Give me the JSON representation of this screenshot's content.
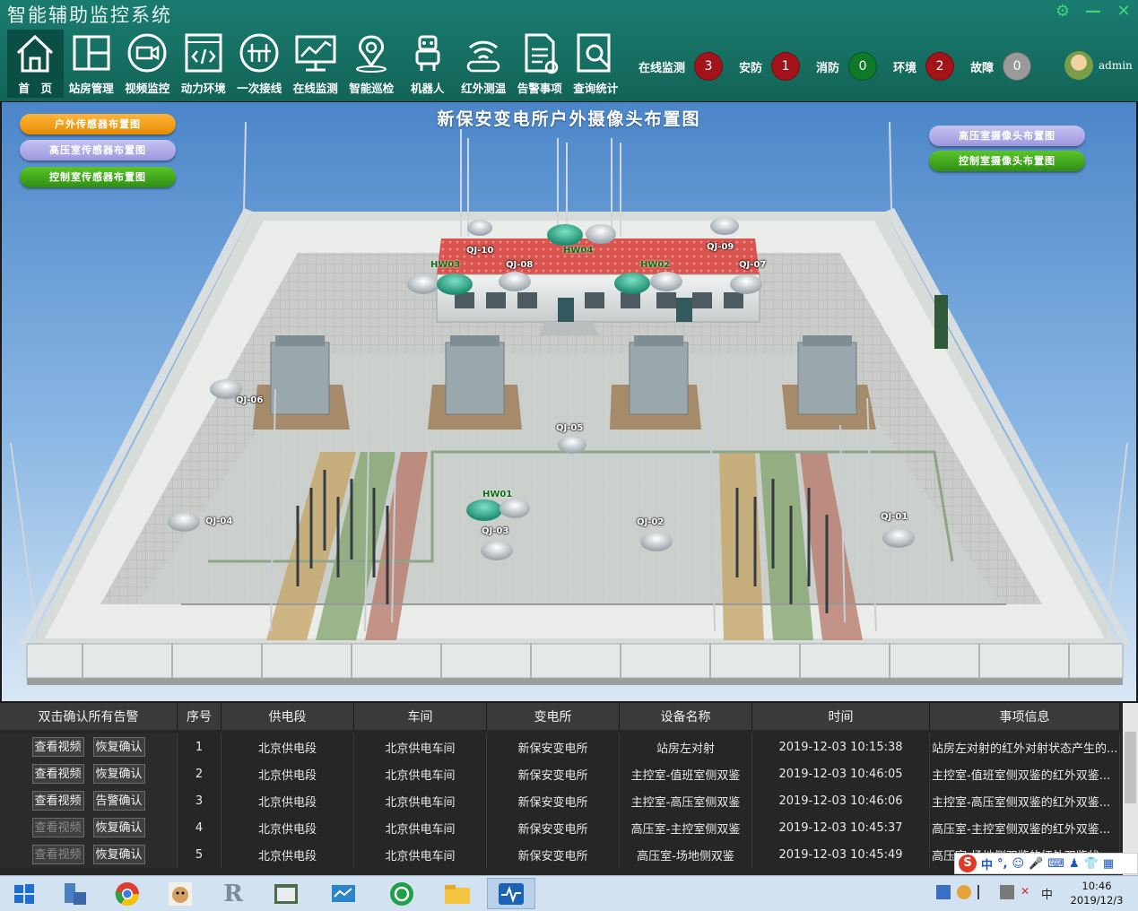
{
  "app": {
    "title": "智能辅助监控系统"
  },
  "nav": {
    "items": [
      {
        "label": "首　页",
        "icon": "home-icon"
      },
      {
        "label": "站房管理",
        "icon": "layout-icon"
      },
      {
        "label": "视频监控",
        "icon": "video-camera-icon"
      },
      {
        "label": "动力环境",
        "icon": "code-window-icon"
      },
      {
        "label": "一次接线",
        "icon": "wiring-icon"
      },
      {
        "label": "在线监测",
        "icon": "monitor-chart-icon"
      },
      {
        "label": "智能巡检",
        "icon": "location-pin-icon"
      },
      {
        "label": "机器人",
        "icon": "robot-icon"
      },
      {
        "label": "红外测温",
        "icon": "infrared-icon"
      },
      {
        "label": "告警事项",
        "icon": "document-icon"
      },
      {
        "label": "查询统计",
        "icon": "search-document-icon"
      }
    ]
  },
  "status": [
    {
      "label": "在线监测",
      "count": "3",
      "color": "#a3141a"
    },
    {
      "label": "安防",
      "count": "1",
      "color": "#a3141a"
    },
    {
      "label": "消防",
      "count": "0",
      "color": "#0e7a2a"
    },
    {
      "label": "环境",
      "count": "2",
      "color": "#a3141a"
    },
    {
      "label": "故障",
      "count": "0",
      "color": "#9a9a9a"
    }
  ],
  "user": {
    "name": "admin"
  },
  "map": {
    "title": "新保安变电所户外摄像头布置图",
    "left_buttons": [
      "户外传感器布置图",
      "高压室传感器布置图",
      "控制室传感器布置图"
    ],
    "right_buttons": [
      "高压室摄像头布置图",
      "控制室摄像头布置图"
    ],
    "cameras": [
      "QJ-10",
      "QJ-09",
      "QJ-08",
      "QJ-07",
      "QJ-06",
      "QJ-05",
      "QJ-04",
      "QJ-03",
      "QJ-02",
      "QJ-01"
    ],
    "thermal": [
      "HW04",
      "HW03",
      "HW02",
      "HW01"
    ]
  },
  "table": {
    "headers": [
      "双击确认所有告警",
      "序号",
      "供电段",
      "车间",
      "变电所",
      "设备名称",
      "时间",
      "事项信息"
    ],
    "rows": [
      {
        "btn1": "查看视频",
        "btn2": "恢复确认",
        "no": "1",
        "section": "北京供电段",
        "workshop": "北京供电车间",
        "station": "新保安变电所",
        "device": "站房左对射",
        "time": "2019-12-03 10:15:38",
        "info": "站房左对射的红外对射状态产生的..."
      },
      {
        "btn1": "查看视频",
        "btn2": "恢复确认",
        "no": "2",
        "section": "北京供电段",
        "workshop": "北京供电车间",
        "station": "新保安变电所",
        "device": "主控室-值班室侧双鉴",
        "time": "2019-12-03 10:46:05",
        "info": "主控室-值班室侧双鉴的红外双鉴..."
      },
      {
        "btn1": "查看视频",
        "btn2": "告警确认",
        "no": "3",
        "section": "北京供电段",
        "workshop": "北京供电车间",
        "station": "新保安变电所",
        "device": "主控室-高压室侧双鉴",
        "time": "2019-12-03 10:46:06",
        "info": "主控室-高压室侧双鉴的红外双鉴..."
      },
      {
        "btn1": "查看视频",
        "btn2": "恢复确认",
        "no": "4",
        "section": "北京供电段",
        "workshop": "北京供电车间",
        "station": "新保安变电所",
        "device": "高压室-主控室侧双鉴",
        "time": "2019-12-03 10:45:37",
        "info": "高压室-主控室侧双鉴的红外双鉴..."
      },
      {
        "btn1": "查看视频",
        "btn2": "恢复确认",
        "no": "5",
        "section": "北京供电段",
        "workshop": "北京供电车间",
        "station": "新保安变电所",
        "device": "高压室-场地侧双鉴",
        "time": "2019-12-03 10:45:49",
        "info": "高压室-场地侧双鉴的红外双鉴状..."
      }
    ]
  },
  "taskbar": {
    "time": "10:46",
    "date": "2019/12/3",
    "ime": "中",
    "tray_lang": "中"
  }
}
